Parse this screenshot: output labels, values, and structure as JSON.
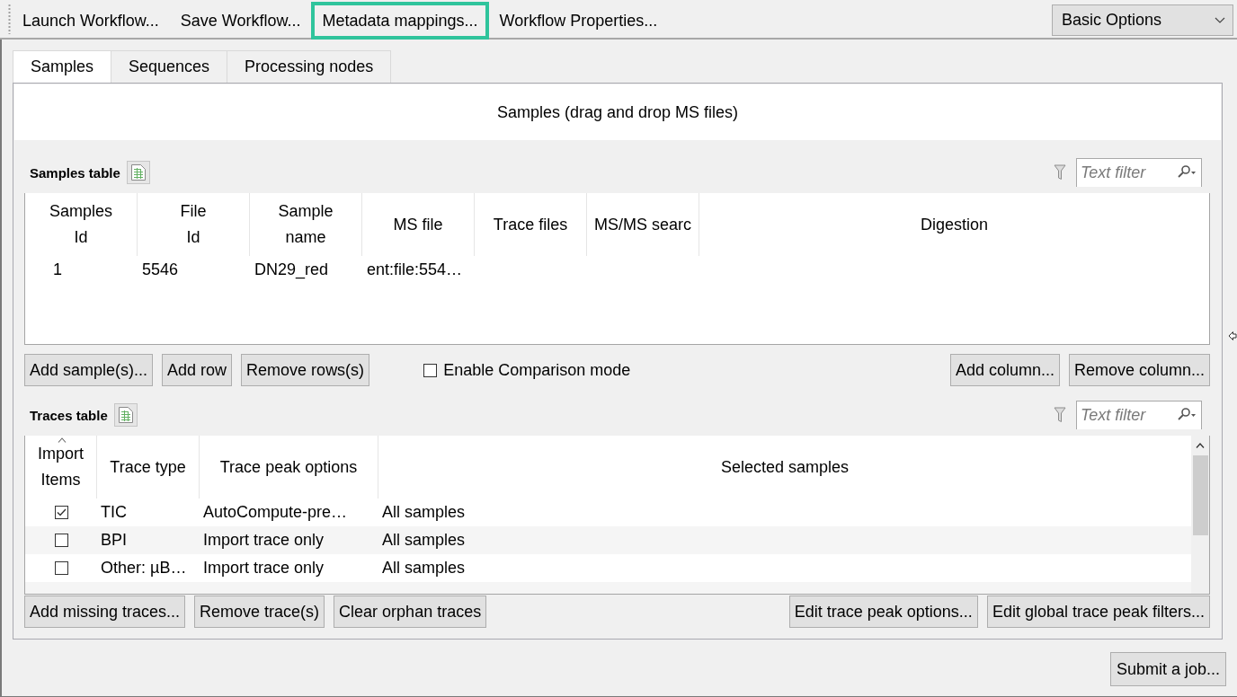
{
  "toolbar": {
    "buttons": [
      {
        "label": "Launch Workflow...",
        "highlighted": false
      },
      {
        "label": "Save Workflow...",
        "highlighted": false
      },
      {
        "label": "Metadata mappings...",
        "highlighted": true
      },
      {
        "label": "Workflow Properties...",
        "highlighted": false
      }
    ],
    "mode_dropdown": {
      "value": "Basic Options"
    }
  },
  "tabs": [
    {
      "label": "Samples",
      "selected": true
    },
    {
      "label": "Sequences",
      "selected": false
    },
    {
      "label": "Processing nodes",
      "selected": false
    }
  ],
  "samples_tab": {
    "drop_zone": "Samples (drag and drop MS files)",
    "samples_table": {
      "title": "Samples table",
      "filter": {
        "placeholder": "Text filter"
      },
      "columns": [
        "Samples\nId",
        "File\nId",
        "Sample\nname",
        "MS file",
        "Trace files",
        "MS/MS searc",
        "Digestion"
      ],
      "rows": [
        {
          "cells": [
            "1",
            "5546",
            "DN29_red",
            "ent:file:554…"
          ]
        }
      ]
    },
    "sample_buttons": [
      "Add sample(s)...",
      "Add row",
      "Remove rows(s)"
    ],
    "comparison_mode": {
      "label": "Enable Comparison mode",
      "checked": false
    },
    "column_buttons": [
      "Add column...",
      "Remove column..."
    ],
    "traces_table": {
      "title": "Traces table",
      "filter": {
        "placeholder": "Text filter"
      },
      "columns": [
        {
          "label": "Import\nItems",
          "sorted": true
        },
        {
          "label": "Trace type",
          "sorted": false
        },
        {
          "label": "Trace peak options",
          "sorted": false
        },
        {
          "label": "Selected samples",
          "sorted": false
        }
      ],
      "rows": [
        {
          "checked": true,
          "trace_type": "TIC",
          "trace_peak_options": "AutoCompute-pre…",
          "selected_samples": "All samples"
        },
        {
          "checked": false,
          "trace_type": "BPI",
          "trace_peak_options": "Import trace only",
          "selected_samples": "All samples"
        },
        {
          "checked": false,
          "trace_type": "Other: µB…",
          "trace_peak_options": "Import trace only",
          "selected_samples": "All samples"
        }
      ]
    },
    "trace_buttons_left": [
      "Add missing traces...",
      "Remove trace(s)",
      "Clear orphan traces"
    ],
    "trace_buttons_right": [
      "Edit trace peak options...",
      "Edit global trace peak filters..."
    ]
  },
  "submit_button": "Submit a job..."
}
